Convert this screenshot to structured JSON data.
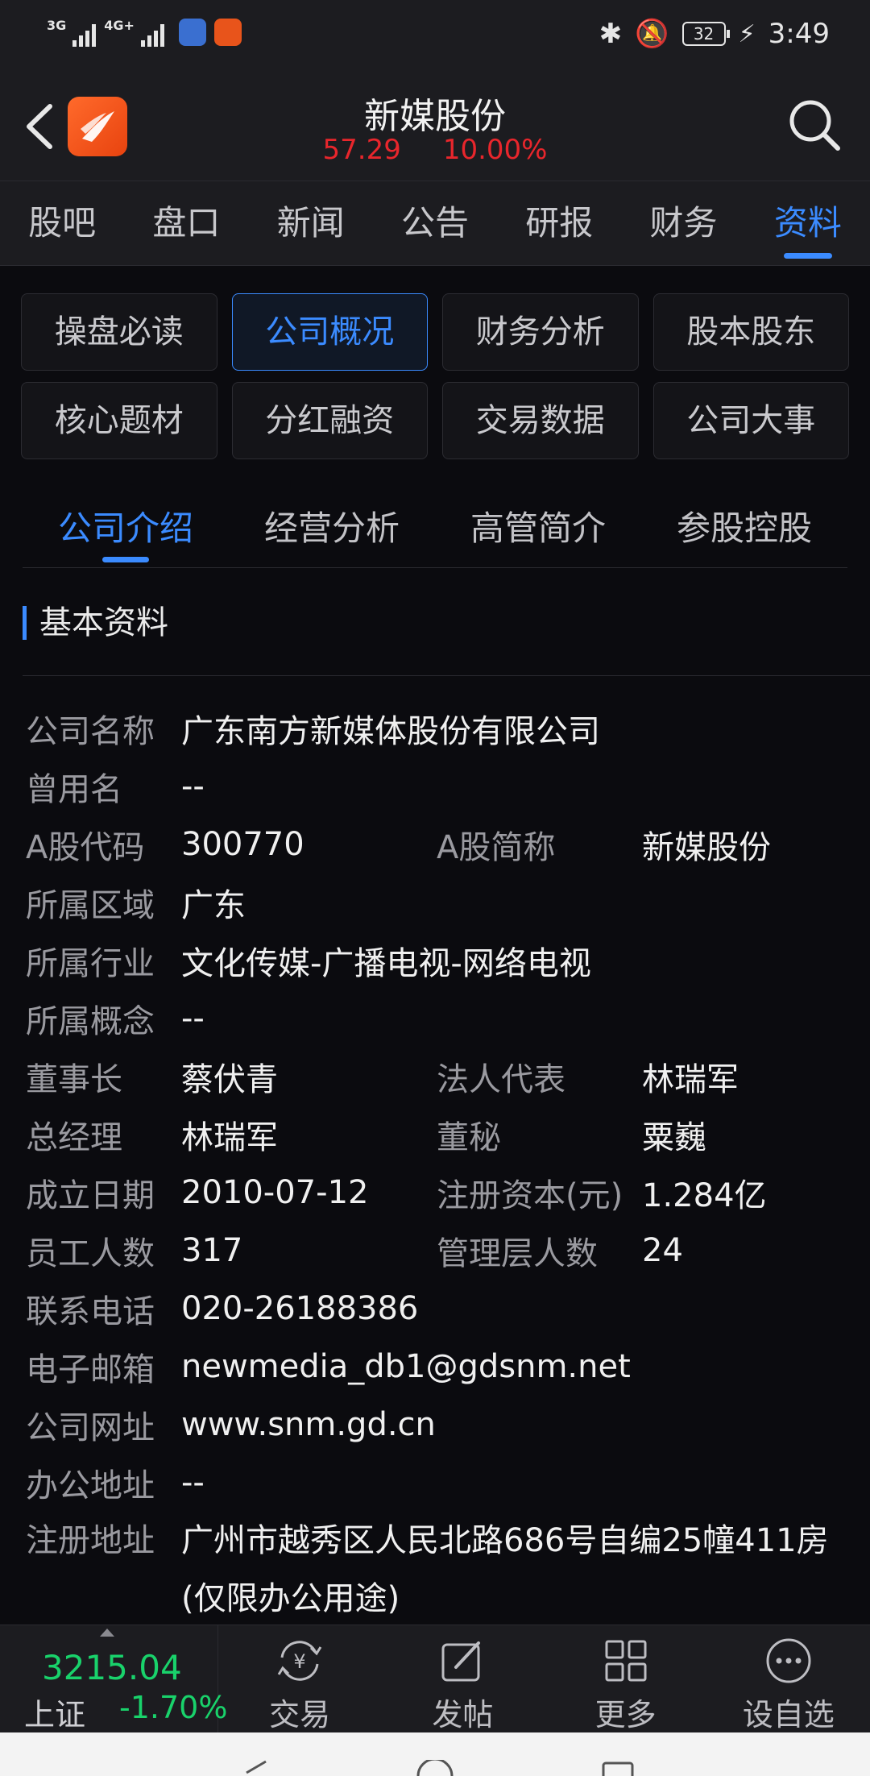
{
  "status": {
    "sig1": "3G",
    "sig2": "4G+",
    "battery": "32",
    "time": "3:49"
  },
  "header": {
    "title": "新媒股份",
    "price": "57.29",
    "change": "10.00%"
  },
  "tabs": [
    {
      "label": "股吧"
    },
    {
      "label": "盘口"
    },
    {
      "label": "新闻"
    },
    {
      "label": "公告"
    },
    {
      "label": "研报"
    },
    {
      "label": "财务"
    },
    {
      "label": "资料"
    }
  ],
  "chips": [
    {
      "label": "操盘必读"
    },
    {
      "label": "公司概况"
    },
    {
      "label": "财务分析"
    },
    {
      "label": "股本股东"
    },
    {
      "label": "核心题材"
    },
    {
      "label": "分红融资"
    },
    {
      "label": "交易数据"
    },
    {
      "label": "公司大事"
    }
  ],
  "subtabs": [
    {
      "label": "公司介绍"
    },
    {
      "label": "经营分析"
    },
    {
      "label": "高管简介"
    },
    {
      "label": "参股控股"
    }
  ],
  "section_title": "基本资料",
  "info": {
    "company_name": {
      "label": "公司名称",
      "value": "广东南方新媒体股份有限公司"
    },
    "former_name": {
      "label": "曾用名",
      "value": "--"
    },
    "a_code": {
      "label": "A股代码",
      "value": "300770"
    },
    "a_short": {
      "label": "A股简称",
      "value": "新媒股份"
    },
    "region": {
      "label": "所属区域",
      "value": "广东"
    },
    "industry": {
      "label": "所属行业",
      "value": "文化传媒-广播电视-网络电视"
    },
    "concept": {
      "label": "所属概念",
      "value": "--"
    },
    "chairman": {
      "label": "董事长",
      "value": "蔡伏青"
    },
    "legal_rep": {
      "label": "法人代表",
      "value": "林瑞军"
    },
    "gm": {
      "label": "总经理",
      "value": "林瑞军"
    },
    "secretary": {
      "label": "董秘",
      "value": "粟巍"
    },
    "founded": {
      "label": "成立日期",
      "value": "2010-07-12"
    },
    "capital": {
      "label": "注册资本(元)",
      "value": "1.284亿"
    },
    "employees": {
      "label": "员工人数",
      "value": "317"
    },
    "managers": {
      "label": "管理层人数",
      "value": "24"
    },
    "phone": {
      "label": "联系电话",
      "value": "020-26188386"
    },
    "email": {
      "label": "电子邮箱",
      "value": "newmedia_db1@gdsnm.net"
    },
    "website": {
      "label": "公司网址",
      "value": "www.snm.gd.cn"
    },
    "office": {
      "label": "办公地址",
      "value": "--"
    },
    "reg_address": {
      "label": "注册地址",
      "value": "广州市越秀区人民北路686号自编25幢411房",
      "value2": "(仅限办公用途)"
    }
  },
  "bottom": {
    "index_value": "3215.04",
    "index_name": "上证",
    "index_change": "-1.70%",
    "trade": "交易",
    "post": "发帖",
    "more": "更多",
    "watch": "设自选"
  },
  "colors": {
    "accent": "#3b8bff",
    "up_red": "#e8262c",
    "down_green": "#19d26b"
  }
}
